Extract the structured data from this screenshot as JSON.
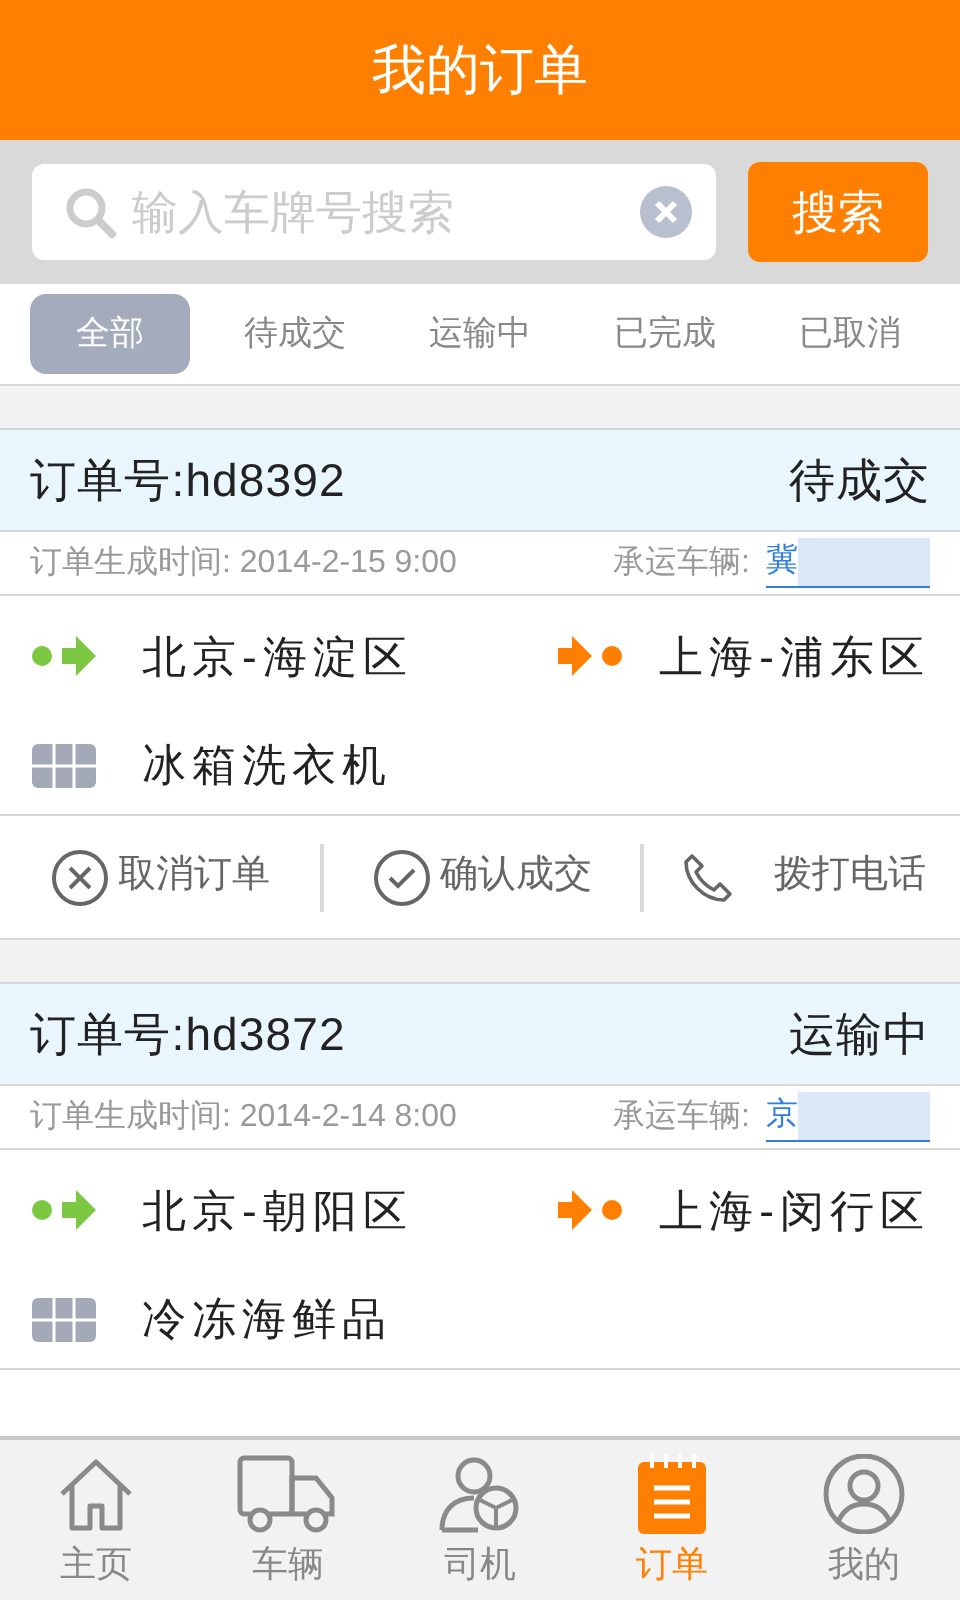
{
  "header": {
    "title": "我的订单"
  },
  "search": {
    "placeholder": "输入车牌号搜索",
    "button": "搜索"
  },
  "filter_tabs": [
    {
      "label": "全部",
      "selected": true
    },
    {
      "label": "待成交",
      "selected": false
    },
    {
      "label": "运输中",
      "selected": false
    },
    {
      "label": "已完成",
      "selected": false
    },
    {
      "label": "已取消",
      "selected": false
    }
  ],
  "orders": [
    {
      "number": "订单号:hd8392",
      "status": "待成交",
      "created": "订单生成时间: 2014-2-15  9:00",
      "vehicle_label": "承运车辆:",
      "vehicle": "冀",
      "from": "北京-海淀区",
      "to": "上海-浦东区",
      "goods": "冰箱洗衣机",
      "actions": [
        {
          "kind": "cancel",
          "label": "取消订单"
        },
        {
          "kind": "confirm",
          "label": "确认成交"
        },
        {
          "kind": "phone",
          "label": "拨打电话"
        }
      ]
    },
    {
      "number": "订单号:hd3872",
      "status": "运输中",
      "created": "订单生成时间: 2014-2-14  8:00",
      "vehicle_label": "承运车辆:",
      "vehicle": "京",
      "from": "北京-朝阳区",
      "to": "上海-闵行区",
      "goods": "冷冻海鲜品"
    }
  ],
  "bottom_nav": [
    {
      "kind": "home",
      "label": "主页",
      "selected": false
    },
    {
      "kind": "truck",
      "label": "车辆",
      "selected": false
    },
    {
      "kind": "driver",
      "label": "司机",
      "selected": false
    },
    {
      "kind": "orders",
      "label": "订单",
      "selected": true
    },
    {
      "kind": "profile",
      "label": "我的",
      "selected": false
    }
  ]
}
